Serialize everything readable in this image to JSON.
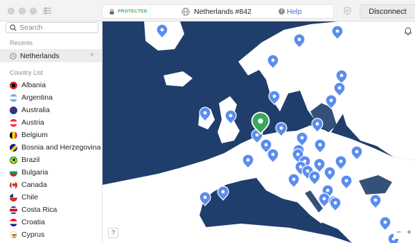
{
  "titlebar": {
    "status": "PROTECTED",
    "server": "Netherlands #842",
    "help": "Help",
    "disconnect": "Disconnect"
  },
  "sidebar": {
    "search_placeholder": "Search",
    "recents_label": "Recents",
    "recent_items": [
      {
        "label": "Netherlands",
        "remove": "×"
      }
    ],
    "country_list_label": "Country List",
    "countries": [
      {
        "label": "Albania"
      },
      {
        "label": "Argentina"
      },
      {
        "label": "Australia"
      },
      {
        "label": "Austria"
      },
      {
        "label": "Belgium"
      },
      {
        "label": "Bosnia and Herzegovina"
      },
      {
        "label": "Brazil"
      },
      {
        "label": "Bulgaria"
      },
      {
        "label": "Canada"
      },
      {
        "label": "Chile"
      },
      {
        "label": "Costa Rica"
      },
      {
        "label": "Croatia"
      },
      {
        "label": "Cyprus"
      }
    ]
  },
  "map": {
    "help_button": "?",
    "zoom_out": "−",
    "zoom_in": "+",
    "colors": {
      "sea": "#1f3e6b",
      "land": "#ffffff",
      "land_edge": "#dfe7f2",
      "marker": "#5b8def",
      "marker_connected": "#3aa75a",
      "marker_inner": "#ffffff"
    }
  },
  "icons": {
    "lock": "lock-icon",
    "globe": "globe-icon",
    "help": "help-circle-icon",
    "shield": "shield-icon",
    "search": "search-icon",
    "clock": "clock-icon",
    "bell": "bell-icon",
    "sidebar": "sidebar-toggle-icon"
  }
}
